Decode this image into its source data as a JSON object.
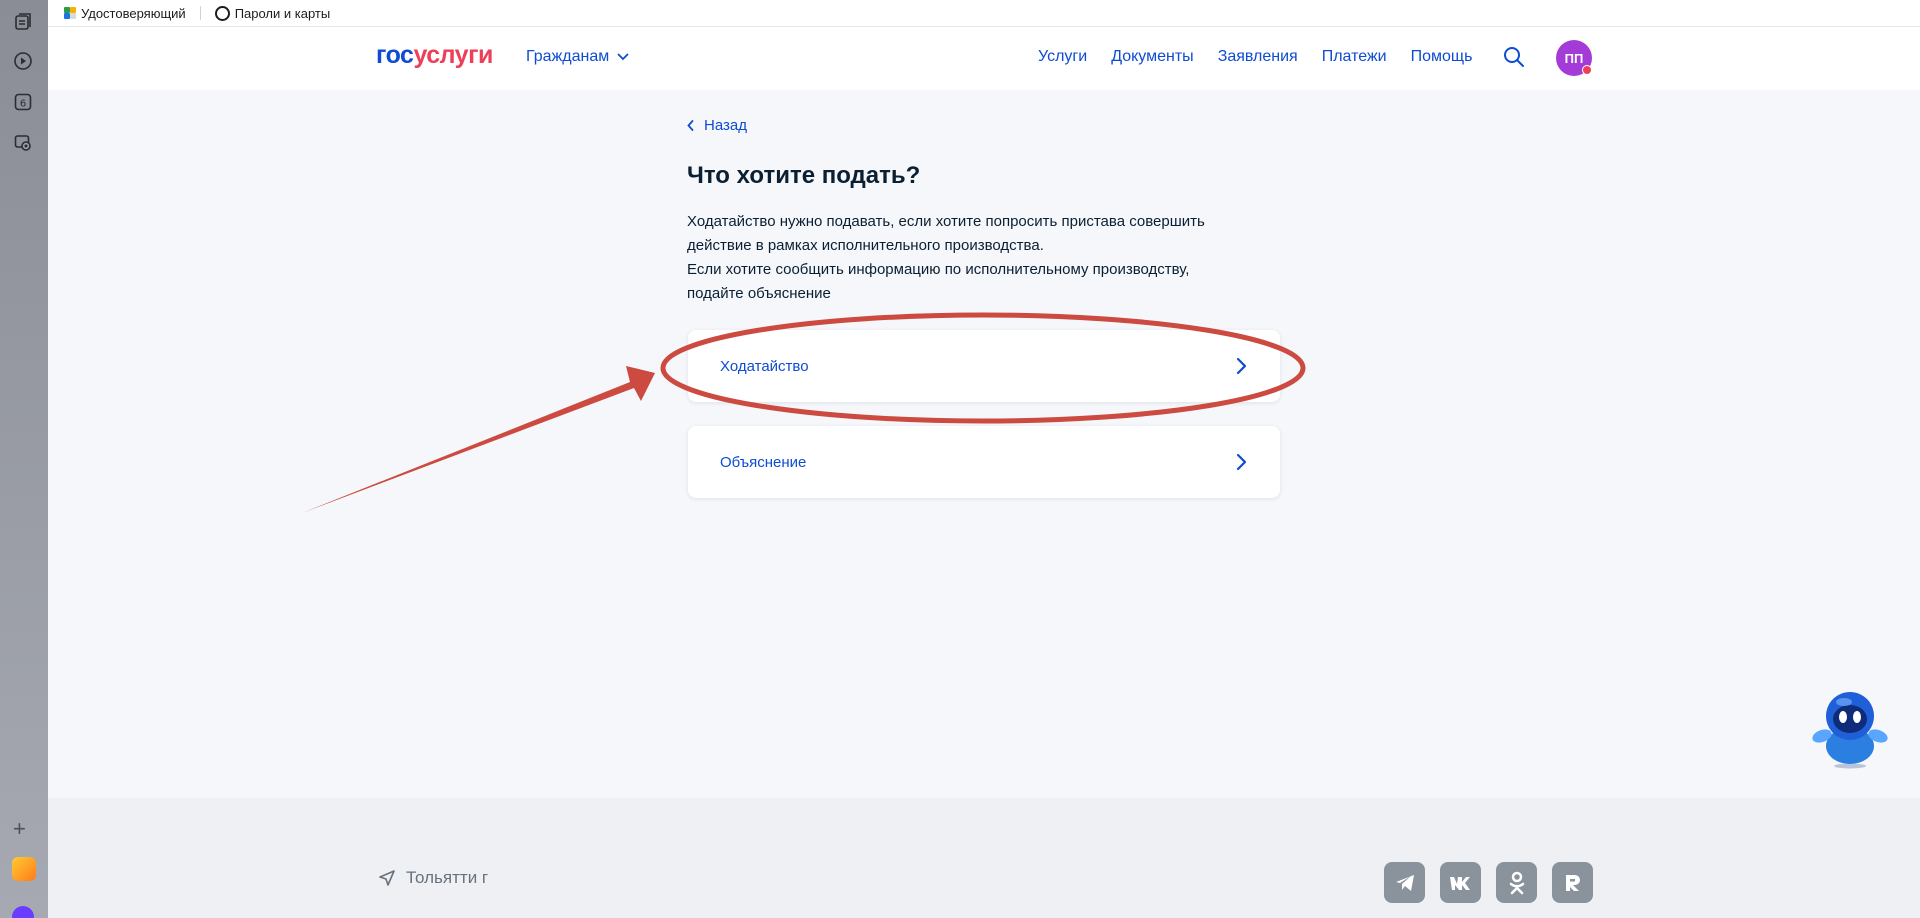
{
  "bookmarks": {
    "item1_label": "Удостоверяющий",
    "item2_label": "Пароли и карты"
  },
  "header": {
    "logo_part1": "гос",
    "logo_part2": "услуги",
    "citizens_label": "Гражданам",
    "nav": [
      "Услуги",
      "Документы",
      "Заявления",
      "Платежи",
      "Помощь"
    ],
    "avatar_initials": "ПП"
  },
  "main": {
    "back_label": "Назад",
    "title": "Что хотите подать?",
    "description_line1": "Ходатайство нужно подавать, если хотите попросить пристава совершить действие в рамках исполнительного производства.",
    "description_line2": "Если хотите сообщить информацию по исполнительному производству, подайте объяснение",
    "options": [
      "Ходатайство",
      "Объяснение"
    ]
  },
  "footer": {
    "location": "Тольятти г",
    "social_icons": [
      "telegram-icon",
      "vk-icon",
      "odnoklassniki-icon",
      "rutube-icon"
    ]
  },
  "colors": {
    "accent": "#0d4cd3",
    "brand_red": "#ee3f58",
    "annotation_red": "#cc4a3f",
    "avatar": "#a43bd8"
  }
}
